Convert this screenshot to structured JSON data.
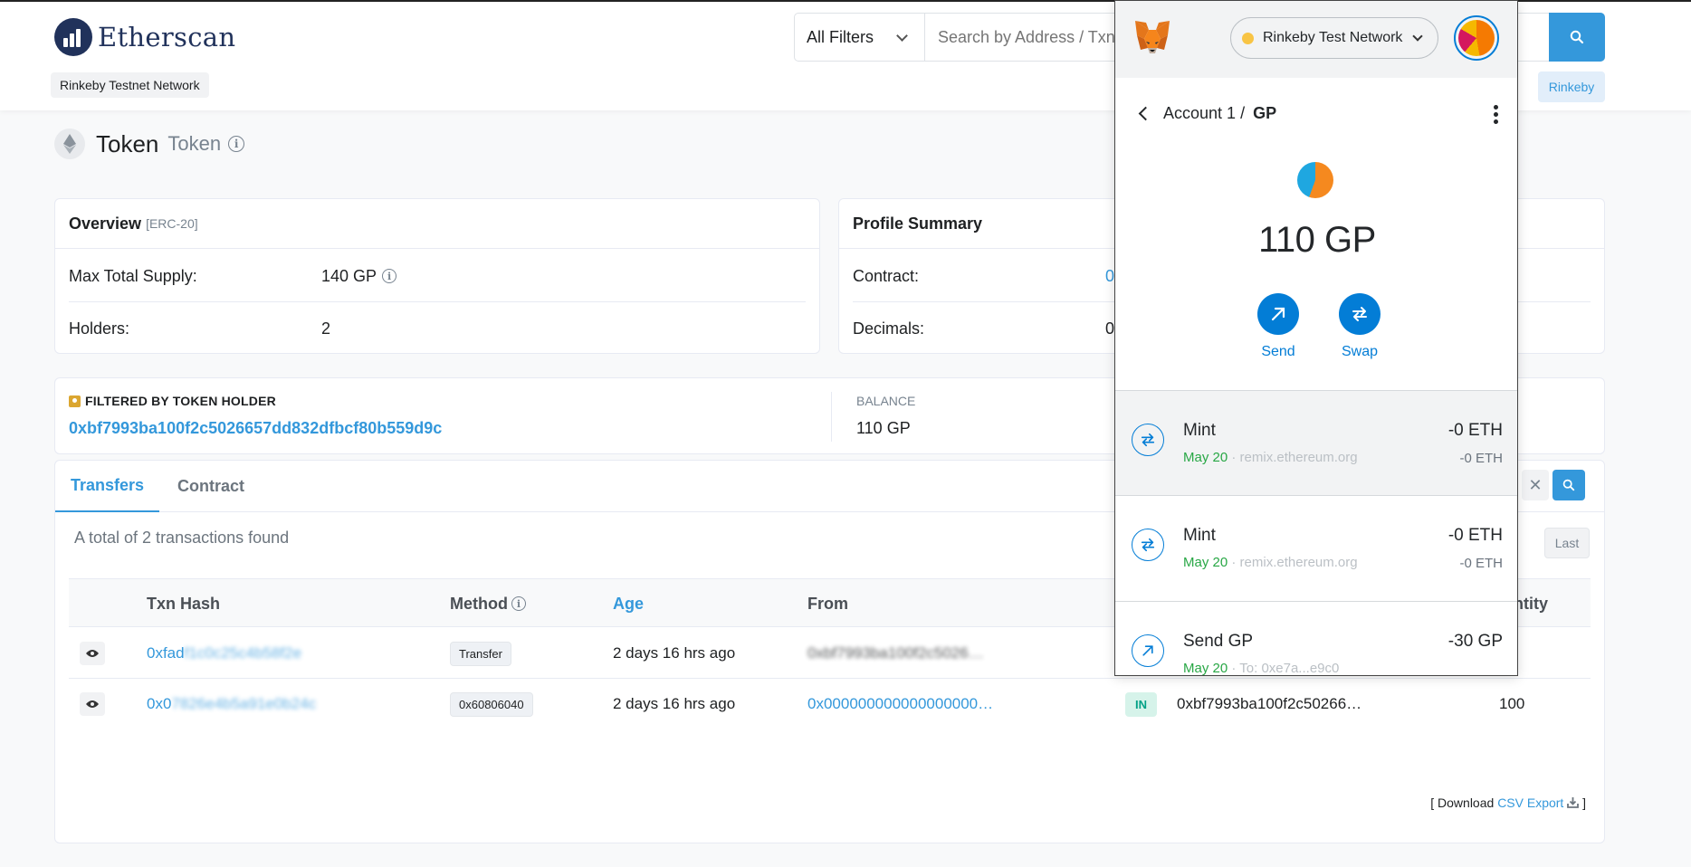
{
  "header": {
    "logo_text": "Etherscan",
    "network_badge": "Rinkeby Testnet Network",
    "filter_label": "All Filters",
    "search_placeholder": "Search by Address / Txn Hash / Block / Token / Ens",
    "network_pill": "Rinkeby"
  },
  "page": {
    "title": "Token",
    "subtitle": "Token"
  },
  "overview": {
    "title": "Overview",
    "standard": "[ERC-20]",
    "rows": [
      {
        "label": "Max Total Supply:",
        "value": "140 GP"
      },
      {
        "label": "Holders:",
        "value": "2"
      }
    ]
  },
  "profile": {
    "title": "Profile Summary",
    "rows": [
      {
        "label": "Contract:",
        "value": "0"
      },
      {
        "label": "Decimals:",
        "value": "0"
      }
    ]
  },
  "filtered": {
    "title": "FILTERED BY TOKEN HOLDER",
    "address": "0xbf7993ba100f2c5026657dd832dfbcf80b559d9c",
    "balance_label": "BALANCE",
    "balance_value": "110 GP"
  },
  "tabs": [
    {
      "label": "Transfers",
      "active": true
    },
    {
      "label": "Contract",
      "active": false
    }
  ],
  "transfers": {
    "total_text": "A total of 2 transactions found",
    "last_button": "Last",
    "columns": [
      "Txn Hash",
      "Method",
      "Age",
      "From",
      "Quantity"
    ],
    "quantity_partial": "ntity",
    "rows": [
      {
        "hash": "0xfad",
        "hash_blur": "f1c0c25c4b58f2e",
        "method": "Transfer",
        "age": "2 days 16 hrs ago",
        "from": "0xbf7993ba100f2c5026…",
        "direction": "",
        "to": "",
        "quantity": ""
      },
      {
        "hash": "0x0",
        "hash_blur": "7826e4b5a91e0b24c",
        "method": "0x60806040",
        "age": "2 days 16 hrs ago",
        "from": "0x000000000000000000…",
        "direction": "IN",
        "to": "0xbf7993ba100f2c50266…",
        "quantity": "100"
      }
    ],
    "download_prefix": "[ Download ",
    "download_link": "CSV Export",
    "download_suffix": " ]"
  },
  "metamask": {
    "network": "Rinkeby Test Network",
    "account_label": "Account 1",
    "account_sep": " / ",
    "token_symbol": "GP",
    "balance": "110 GP",
    "actions": [
      {
        "label": "Send"
      },
      {
        "label": "Swap"
      }
    ],
    "transactions": [
      {
        "title": "Mint",
        "date": "May 20",
        "origin": "remix.ethereum.org",
        "amount": "-0 ETH",
        "amount_sub": "-0 ETH",
        "type": "swap"
      },
      {
        "title": "Mint",
        "date": "May 20",
        "origin": "remix.ethereum.org",
        "amount": "-0 ETH",
        "amount_sub": "-0 ETH",
        "type": "swap"
      },
      {
        "title": "Send GP",
        "date": "May 20",
        "origin": "To: 0xe7a...e9c0",
        "amount": "-30 GP",
        "amount_sub": "",
        "type": "send"
      }
    ]
  },
  "colors": {
    "etherscan_blue": "#3498db",
    "metamask_blue": "#037dd6",
    "logo_navy": "#21325b",
    "in_green": "#00a186"
  }
}
